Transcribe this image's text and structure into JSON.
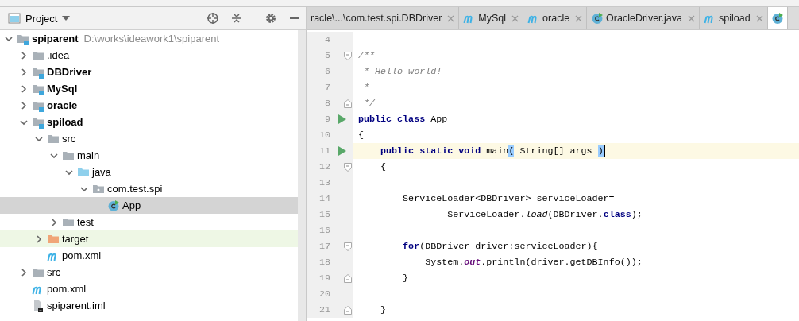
{
  "project_panel": {
    "title": "Project",
    "tree": [
      {
        "label": "spiparent",
        "note": "D:\\works\\ideawork1\\spiparent",
        "kind": "module",
        "expanded": true,
        "selected": false,
        "hovered": false,
        "children": [
          {
            "label": ".idea",
            "kind": "folder",
            "expanded": false,
            "selected": false,
            "hovered": false
          },
          {
            "label": "DBDriver",
            "kind": "module",
            "expanded": false,
            "selected": false,
            "hovered": false
          },
          {
            "label": "MySql",
            "kind": "module",
            "expanded": false,
            "selected": false,
            "hovered": false
          },
          {
            "label": "oracle",
            "kind": "module",
            "expanded": false,
            "selected": false,
            "hovered": false
          },
          {
            "label": "spiload",
            "kind": "module",
            "expanded": true,
            "selected": false,
            "hovered": false,
            "children": [
              {
                "label": "src",
                "kind": "folder",
                "expanded": true,
                "selected": false,
                "hovered": false,
                "children": [
                  {
                    "label": "main",
                    "kind": "folder",
                    "expanded": true,
                    "selected": false,
                    "hovered": false,
                    "children": [
                      {
                        "label": "java",
                        "kind": "source-folder",
                        "expanded": true,
                        "selected": false,
                        "hovered": false,
                        "children": [
                          {
                            "label": "com.test.spi",
                            "kind": "package",
                            "expanded": true,
                            "selected": false,
                            "hovered": false,
                            "children": [
                              {
                                "label": "App",
                                "kind": "class",
                                "selected": true,
                                "hovered": false
                              }
                            ]
                          }
                        ]
                      }
                    ]
                  },
                  {
                    "label": "test",
                    "kind": "folder",
                    "expanded": false,
                    "selected": false,
                    "hovered": false
                  }
                ]
              },
              {
                "label": "target",
                "kind": "target-folder",
                "expanded": false,
                "selected": false,
                "hovered": true
              },
              {
                "label": "pom.xml",
                "kind": "maven",
                "selected": false,
                "hovered": false
              }
            ]
          },
          {
            "label": "src",
            "kind": "folder",
            "expanded": false,
            "selected": false,
            "hovered": false
          },
          {
            "label": "pom.xml",
            "kind": "maven",
            "selected": false,
            "hovered": false
          },
          {
            "label": "spiparent.iml",
            "kind": "iml",
            "selected": false,
            "hovered": false
          }
        ]
      }
    ]
  },
  "editor_tabs": [
    {
      "label": "racle\\...\\com.test.spi.DBDriver",
      "kind": "plain",
      "selected": false
    },
    {
      "label": "MySql",
      "kind": "maven",
      "selected": false
    },
    {
      "label": "oracle",
      "kind": "maven",
      "selected": false
    },
    {
      "label": "OracleDriver.java",
      "kind": "class",
      "selected": false
    },
    {
      "label": "spiload",
      "kind": "maven",
      "selected": false
    },
    {
      "kind": "class",
      "selected": true
    }
  ],
  "code_lines": [
    {
      "number": "4",
      "run": false,
      "current": false,
      "caret": false,
      "fold_start": false,
      "fold_end": false
    },
    {
      "number": "5",
      "run": false,
      "current": false,
      "caret": false,
      "fold_start": true,
      "fold_end": false,
      "tokens": [
        {
          "text": "/**",
          "kind": "comment"
        }
      ]
    },
    {
      "number": "6",
      "run": false,
      "current": false,
      "caret": false,
      "fold_start": false,
      "fold_end": false,
      "tokens": [
        {
          "text": " * Hello world!",
          "kind": "comment"
        }
      ]
    },
    {
      "number": "7",
      "run": false,
      "current": false,
      "caret": false,
      "fold_start": false,
      "fold_end": false,
      "tokens": [
        {
          "text": " *",
          "kind": "comment"
        }
      ]
    },
    {
      "number": "8",
      "run": false,
      "current": false,
      "caret": false,
      "fold_start": false,
      "fold_end": true,
      "tokens": [
        {
          "text": " */",
          "kind": "comment"
        }
      ]
    },
    {
      "number": "9",
      "run": true,
      "current": false,
      "caret": false,
      "fold_start": false,
      "fold_end": false,
      "tokens": [
        {
          "text": "public class",
          "kind": "keyword"
        },
        {
          "text": " App",
          "kind": "plain"
        }
      ]
    },
    {
      "number": "10",
      "run": false,
      "current": false,
      "caret": false,
      "fold_start": false,
      "fold_end": false,
      "tokens": [
        {
          "text": "{",
          "kind": "plain"
        }
      ]
    },
    {
      "number": "11",
      "run": true,
      "current": true,
      "caret": true,
      "fold_start": false,
      "fold_end": false,
      "tokens": [
        {
          "text": "    public static void",
          "kind": "keyword"
        },
        {
          "text": " main",
          "kind": "plain"
        },
        {
          "text": "(",
          "kind": "match"
        },
        {
          "text": " String[] args ",
          "kind": "plain"
        },
        {
          "text": ")",
          "kind": "match"
        }
      ]
    },
    {
      "number": "12",
      "run": false,
      "current": false,
      "caret": false,
      "fold_start": true,
      "fold_end": false,
      "tokens": [
        {
          "text": "    {",
          "kind": "plain"
        }
      ]
    },
    {
      "number": "13",
      "run": false,
      "current": false,
      "caret": false,
      "fold_start": false,
      "fold_end": false
    },
    {
      "number": "14",
      "run": false,
      "current": false,
      "caret": false,
      "fold_start": false,
      "fold_end": false,
      "tokens": [
        {
          "text": "        ServiceLoader<DBDriver> serviceLoader=",
          "kind": "plain"
        }
      ]
    },
    {
      "number": "15",
      "run": false,
      "current": false,
      "caret": false,
      "fold_start": false,
      "fold_end": false,
      "tokens": [
        {
          "text": "                ServiceLoader.",
          "kind": "plain"
        },
        {
          "text": "load",
          "kind": "italic"
        },
        {
          "text": "(DBDriver.",
          "kind": "plain"
        },
        {
          "text": "class",
          "kind": "keyword"
        },
        {
          "text": ");",
          "kind": "plain"
        }
      ]
    },
    {
      "number": "16",
      "run": false,
      "current": false,
      "caret": false,
      "fold_start": false,
      "fold_end": false
    },
    {
      "number": "17",
      "run": false,
      "current": false,
      "caret": false,
      "fold_start": true,
      "fold_end": false,
      "tokens": [
        {
          "text": "        for",
          "kind": "keyword"
        },
        {
          "text": "(DBDriver driver:serviceLoader){",
          "kind": "plain"
        }
      ]
    },
    {
      "number": "18",
      "run": false,
      "current": false,
      "caret": false,
      "fold_start": false,
      "fold_end": false,
      "tokens": [
        {
          "text": "            System.",
          "kind": "plain"
        },
        {
          "text": "out",
          "kind": "static"
        },
        {
          "text": ".println(driver.getDBInfo());",
          "kind": "plain"
        }
      ]
    },
    {
      "number": "19",
      "run": false,
      "current": false,
      "caret": false,
      "fold_start": false,
      "fold_end": true,
      "tokens": [
        {
          "text": "        }",
          "kind": "plain"
        }
      ]
    },
    {
      "number": "20",
      "run": false,
      "current": false,
      "caret": false,
      "fold_start": false,
      "fold_end": false
    },
    {
      "number": "21",
      "run": false,
      "current": false,
      "caret": false,
      "fold_start": false,
      "fold_end": true,
      "tokens": [
        {
          "text": "    }",
          "kind": "plain"
        }
      ]
    }
  ]
}
